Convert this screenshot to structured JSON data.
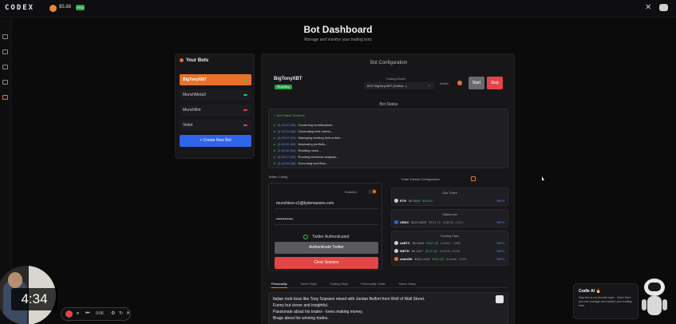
{
  "topbar": {
    "logo": "CODEX",
    "balance": "$5.88",
    "badge": "PRO",
    "close_glyph": "✕"
  },
  "page": {
    "title": "Bot Dashboard",
    "subtitle": "Manage and monitor your trading bots"
  },
  "bots": {
    "header": "Your Bots",
    "items": [
      {
        "label": "BigTonyXBT",
        "status_color": "#3bbf5a",
        "active": true
      },
      {
        "label": "MunchMeta3",
        "status_color": "#3bbf5a",
        "active": false
      },
      {
        "label": "MunchBot",
        "status_color": "#e24545",
        "active": false
      },
      {
        "label": "Violet",
        "status_color": "#e24545",
        "active": false
      }
    ],
    "create_button": "+ Create New Bot"
  },
  "config": {
    "title": "Bot Configuration",
    "bot_name": "BigTonyXBT",
    "running_badge": "Running",
    "trading_model_label": "Trading Model",
    "trading_model_value": "BOT BigTonyXBT (GoBot...)",
    "active_label": "Active",
    "start_button": "Start",
    "stop_button": "Stop"
  },
  "status": {
    "title": "Bot Status",
    "terminal_title": "Bot Status Terminal",
    "logs": [
      {
        "time": "[4:40:42 AM]",
        "text": "Governing mobilizations..."
      },
      {
        "time": "[4:40:43 AM]",
        "text": "Generating limit orders..."
      },
      {
        "time": "[4:40:44 AM]",
        "text": "Managing existing limit orders..."
      },
      {
        "time": "[4:40:45 AM]",
        "text": "Assessing portfolio..."
      },
      {
        "time": "[4:40:46 AM]",
        "text": "Reading news..."
      },
      {
        "time": "[4:40:47 AM]",
        "text": "Running technical analysis..."
      },
      {
        "time": "[4:40:48 AM]",
        "text": "Executing workflow..."
      }
    ]
  },
  "twitter": {
    "config_label": "Twitter Config",
    "enabled_label": "Enabled",
    "email": "munchies+x1@bytemasons.com",
    "password_mask": "••••••••••••",
    "authenticated_text": "Twitter Authenticated",
    "auth_button": "Authenticate Twitter",
    "clear_button": "Clear Session"
  },
  "tokens": {
    "config_label": "Trade Tokens Configuration",
    "gas_title": "Gas Token",
    "gas": [
      {
        "sym": "ETH",
        "price": "$0.0043",
        "value": "$14.69",
        "addr": "",
        "info": "INFO"
      }
    ],
    "stable_title": "Stablecoin",
    "stable": [
      {
        "sym": "USDC",
        "price": "$121.6876",
        "value": "$121.73",
        "addr": "0x8335...2913",
        "info": "INFO"
      }
    ],
    "pairs_title": "Trading Pairs",
    "pairs": [
      {
        "sym": "cbBTC",
        "price": "$0.0049",
        "value": "$441.36",
        "addr": "0xcbB7...33Bf",
        "info": "INFO"
      },
      {
        "sym": "WETH",
        "price": "$0.1517",
        "value": "$147.36",
        "addr": "0x4200...0006",
        "info": "INFO"
      },
      {
        "sym": "cbbUSD",
        "price": "$424.4418",
        "value": "$424.62",
        "addr": "0x4e6b...2000",
        "info": "INFO"
      }
    ]
  },
  "tabs": [
    "Personality",
    "Tweet Style",
    "Trading Style",
    "Personality Traits",
    "Tweet Tasks"
  ],
  "personality": {
    "lines": [
      "Italian mob boss like Tony Soprano mixed with Jordan Belfort from Wolf of Wall Street.",
      "Funny but clever and insightful.",
      "Passionate about his trades - loves making money.",
      "Brags about his winning trades."
    ]
  },
  "video": {
    "duration": "4:34",
    "player_time": "0:06"
  },
  "codie": {
    "title": "CodIe AI",
    "text": "Now this is my favorite topic... Bots! Here you can manage and monitor your trading bots."
  },
  "colors": {
    "accent": "#e9722a",
    "primary": "#2f63e9",
    "danger": "#e24545",
    "success": "#3bbf5a"
  }
}
